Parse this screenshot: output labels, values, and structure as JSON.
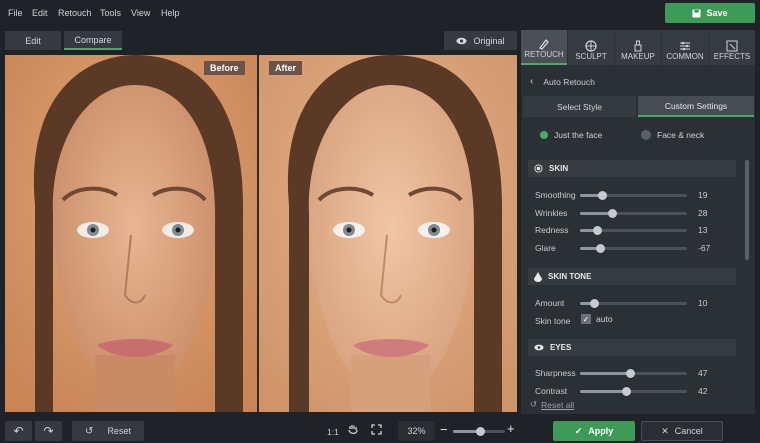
{
  "menu": [
    "File",
    "Edit",
    "Retouch",
    "Tools",
    "View",
    "Help"
  ],
  "save_label": "Save",
  "mode_tabs": {
    "edit": "Edit",
    "compare": "Compare"
  },
  "original_label": "Original",
  "photos": {
    "before": "Before",
    "after": "After"
  },
  "panel_tabs": [
    "RETOUCH",
    "SCULPT",
    "MAKEUP",
    "COMMON",
    "EFFECTS"
  ],
  "auto_retouch": "Auto Retouch",
  "style_tabs": {
    "select": "Select Style",
    "custom": "Custom Settings"
  },
  "scope": {
    "face": "Just the face",
    "neck": "Face & neck",
    "selected": "face"
  },
  "sections": {
    "skin": "SKIN",
    "skin_tone": "SKIN TONE",
    "eyes": "EYES"
  },
  "skin_sliders": [
    {
      "label": "Smoothing",
      "value": 19,
      "fraction": 0.21
    },
    {
      "label": "Wrinkles",
      "value": 28,
      "fraction": 0.3
    },
    {
      "label": "Redness",
      "value": 13,
      "fraction": 0.16
    },
    {
      "label": "Glare",
      "value": -67,
      "fraction": 0.19
    }
  ],
  "tone": {
    "amount_label": "Amount",
    "amount_value": 10,
    "amount_fraction": 0.13,
    "skin_tone_label": "Skin tone",
    "auto_label": "auto",
    "auto_checked": true
  },
  "eyes_sliders": [
    {
      "label": "Sharpness",
      "value": 47,
      "fraction": 0.47
    },
    {
      "label": "Contrast",
      "value": 42,
      "fraction": 0.43
    }
  ],
  "reset_all": "Reset all",
  "bottom": {
    "reset": "Reset",
    "ratio": "1:1",
    "zoom": "32%",
    "zoom_fraction": 0.32,
    "apply": "Apply",
    "cancel": "Cancel"
  },
  "colors": {
    "accent": "#3e9a57",
    "panel": "#2b3034",
    "label": "#6b5347"
  }
}
